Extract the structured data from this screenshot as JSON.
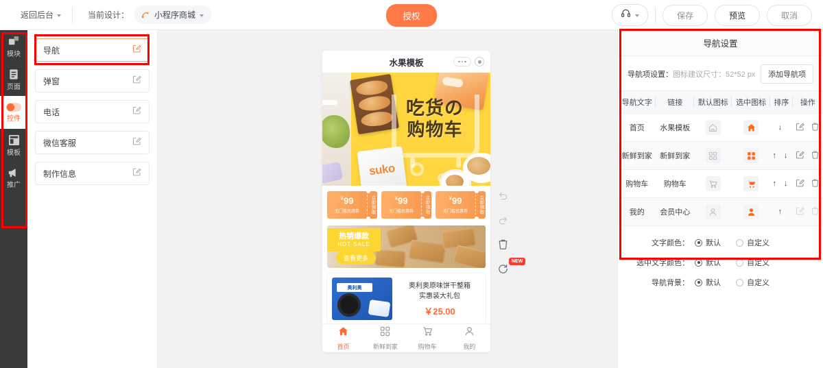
{
  "topbar": {
    "back_label": "返回后台",
    "current_design_label": "当前设计：",
    "design_name": "小程序商城",
    "auth_button": "授权",
    "save_button": "保存",
    "preview_button": "预览",
    "cancel_button": "取消"
  },
  "rail": {
    "items": [
      {
        "label": "模块",
        "icon": "blocks-icon",
        "active": false
      },
      {
        "label": "页面",
        "icon": "page-icon",
        "active": false
      },
      {
        "label": "控件",
        "icon": "toggle-icon",
        "active": true
      },
      {
        "label": "模板",
        "icon": "template-icon",
        "active": false
      },
      {
        "label": "推广",
        "icon": "megaphone-icon",
        "active": false
      }
    ]
  },
  "widgets": {
    "items": [
      {
        "label": "导航",
        "selected": true
      },
      {
        "label": "弹窗",
        "selected": false
      },
      {
        "label": "电话",
        "selected": false
      },
      {
        "label": "微信客服",
        "selected": false
      },
      {
        "label": "制作信息",
        "selected": false
      }
    ]
  },
  "canvas": {
    "tools": [
      {
        "name": "undo-icon",
        "badge": ""
      },
      {
        "name": "redo-icon",
        "badge": ""
      },
      {
        "name": "trash-icon",
        "badge": ""
      },
      {
        "name": "restore-icon",
        "badge": "NEW"
      }
    ]
  },
  "phone": {
    "title": "水果模板",
    "banner": {
      "line1": "吃货の",
      "line2": "购物车",
      "package_text": "suko"
    },
    "coupons": [
      {
        "price": "99",
        "currency": "¥",
        "sub": "无门槛优惠券",
        "action": "立即领取"
      },
      {
        "price": "99",
        "currency": "¥",
        "sub": "无门槛优惠券",
        "action": "立即领取"
      },
      {
        "price": "99",
        "currency": "¥",
        "sub": "无门槛优惠券",
        "action": "立即领取"
      }
    ],
    "hotsale": {
      "title": "热销爆款",
      "subtitle": "HOT SALE",
      "more": "查看更多"
    },
    "product": {
      "title_line1": "奥利奥原味饼干整箱",
      "title_line2": "实惠装大礼包",
      "price": "￥25.00",
      "brand": "奥利奥"
    },
    "nav": [
      {
        "label": "首页",
        "icon": "home-icon",
        "active": true
      },
      {
        "label": "新鲜到家",
        "icon": "grid-icon",
        "active": false
      },
      {
        "label": "购物车",
        "icon": "cart-icon",
        "active": false
      },
      {
        "label": "我的",
        "icon": "user-icon",
        "active": false
      }
    ]
  },
  "right_panel": {
    "title": "导航设置",
    "sub_label": "导航项设置：",
    "sub_hint": "图标建议尺寸：52*52 px",
    "add_button": "添加导航项",
    "columns": [
      "导航文字",
      "链接",
      "默认图标",
      "选中图标",
      "排序",
      "操作"
    ],
    "rows": [
      {
        "text": "首页",
        "link": "水果模板",
        "default_icon": "home-outline-icon",
        "selected_icon": "home-filled-icon",
        "sort": "↓",
        "edit": "edit-icon",
        "delete": "delete-icon",
        "disabled": false
      },
      {
        "text": "新鲜到家",
        "link": "新鲜到家",
        "default_icon": "grid-outline-icon",
        "selected_icon": "grid-filled-icon",
        "sort": "↑ ↓",
        "edit": "edit-icon",
        "delete": "delete-icon",
        "disabled": false
      },
      {
        "text": "购物车",
        "link": "购物车",
        "default_icon": "cart-outline-icon",
        "selected_icon": "cart-filled-icon",
        "sort": "↑ ↓",
        "edit": "edit-icon",
        "delete": "delete-icon",
        "disabled": false
      },
      {
        "text": "我的",
        "link": "会员中心",
        "default_icon": "user-outline-icon",
        "selected_icon": "user-filled-icon",
        "sort": "↑",
        "edit": "edit-icon",
        "delete": "delete-icon",
        "disabled": true
      }
    ],
    "options": [
      {
        "label": "文字颜色：",
        "choices": [
          "默认",
          "自定义"
        ],
        "selected": "默认"
      },
      {
        "label": "选中文字颜色：",
        "choices": [
          "默认",
          "自定义"
        ],
        "selected": "默认"
      },
      {
        "label": "导航背景：",
        "choices": [
          "默认",
          "自定义"
        ],
        "selected": "默认"
      }
    ]
  },
  "colors": {
    "accent": "#ff6a35",
    "auth_button": "#ff7a45",
    "annotation": "#ff0000",
    "rail_bg": "#3a3a3a",
    "banner_yellow": "#ffd63f"
  }
}
